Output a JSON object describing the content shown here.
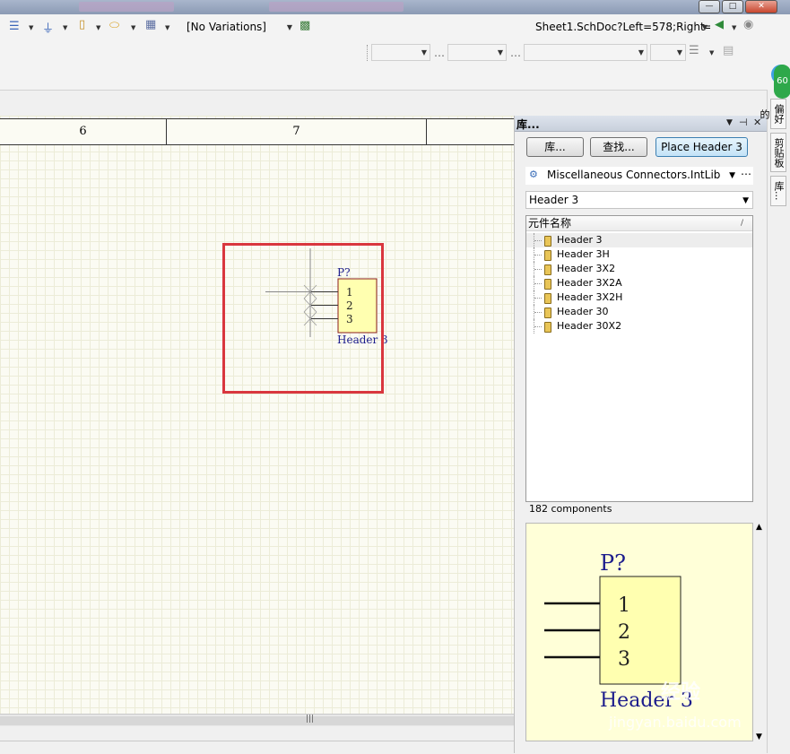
{
  "toolbar": {
    "variations": "[No Variations]",
    "document_path": "Sheet1.SchDoc?Left=578;Right="
  },
  "sheet": {
    "rulers": [
      "6",
      "7"
    ],
    "designator": "P?",
    "pins": [
      "1",
      "2",
      "3"
    ],
    "comment": "Header 3"
  },
  "panel": {
    "title": "库...",
    "buttons": {
      "libraries": "库...",
      "search": "查找...",
      "place": "Place Header 3"
    },
    "library": "Miscellaneous Connectors.IntLib",
    "filter": "Header 3",
    "list_header": "元件名称",
    "components": [
      "Header 3",
      "Header 3H",
      "Header 3X2",
      "Header 3X2A",
      "Header 3X2H",
      "Header 30",
      "Header 30X2"
    ],
    "count": "182 components",
    "preview": {
      "designator": "P?",
      "pins": [
        "1",
        "2",
        "3"
      ],
      "comment": "Header 3"
    }
  },
  "dock": {
    "tabs": [
      "偏好的",
      "剪贴板",
      "库..."
    ],
    "badge": "60"
  },
  "watermark": {
    "brand": "经验",
    "url": "jingyan.baidu.com"
  },
  "colors": {
    "highlight": "#d9363e",
    "component_fill": "#ffffb0",
    "schematic_text": "#1c1c8c",
    "sheet_bg": "#fbfbf3"
  }
}
